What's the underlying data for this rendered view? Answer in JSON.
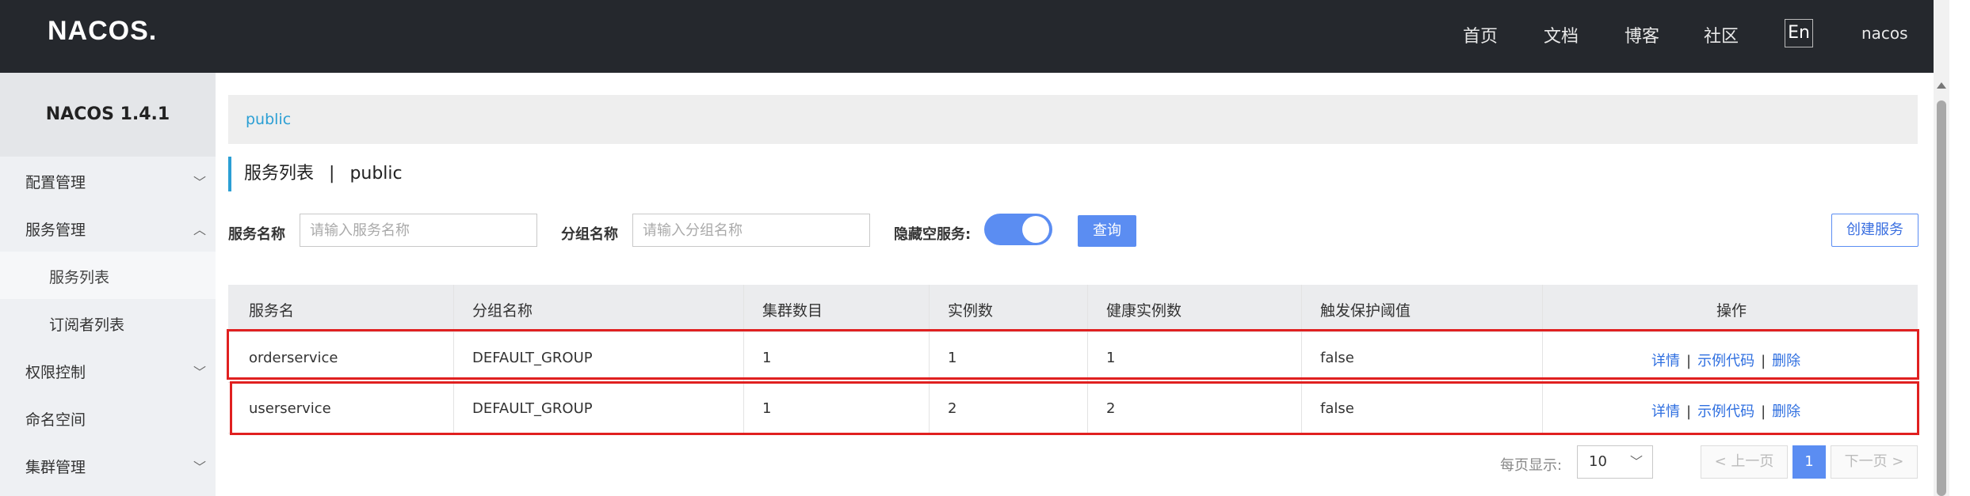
{
  "header": {
    "logo": "NACOS.",
    "nav": [
      "首页",
      "文档",
      "博客",
      "社区"
    ],
    "lang": "En",
    "user": "nacos"
  },
  "sidebar": {
    "title": "NACOS 1.4.1",
    "items": [
      {
        "label": "配置管理",
        "chevron": "down"
      },
      {
        "label": "服务管理",
        "chevron": "up"
      },
      {
        "label": "服务列表",
        "sub": true
      },
      {
        "label": "订阅者列表",
        "sub": true
      },
      {
        "label": "权限控制",
        "chevron": "down"
      },
      {
        "label": "命名空间"
      },
      {
        "label": "集群管理",
        "chevron": "down"
      }
    ]
  },
  "breadcrumb": {
    "namespace": "public"
  },
  "page": {
    "title": "服务列表",
    "separator": "|",
    "namespace": "public"
  },
  "filters": {
    "service_label": "服务名称",
    "service_placeholder": "请输入服务名称",
    "group_label": "分组名称",
    "group_placeholder": "请输入分组名称",
    "hide_empty_label": "隐藏空服务:",
    "hide_empty_on": true,
    "query_button": "查询",
    "create_button": "创建服务"
  },
  "table": {
    "columns": [
      "服务名",
      "分组名称",
      "集群数目",
      "实例数",
      "健康实例数",
      "触发保护阈值",
      "操作"
    ],
    "rows": [
      {
        "name": "orderservice",
        "group": "DEFAULT_GROUP",
        "clusters": "1",
        "instances": "1",
        "healthy": "1",
        "threshold": "false"
      },
      {
        "name": "userservice",
        "group": "DEFAULT_GROUP",
        "clusters": "1",
        "instances": "2",
        "healthy": "2",
        "threshold": "false"
      }
    ],
    "actions": {
      "detail": "详情",
      "sample": "示例代码",
      "delete": "删除",
      "sep": "|"
    }
  },
  "pagination": {
    "page_size_label": "每页显示:",
    "page_size": "10",
    "prev": "上一页",
    "current": "1",
    "next": "下一页"
  },
  "colors": {
    "accent": "#5b8df2",
    "link": "#2f6fe0",
    "header_bg": "#25282d",
    "highlight": "#e02020"
  }
}
